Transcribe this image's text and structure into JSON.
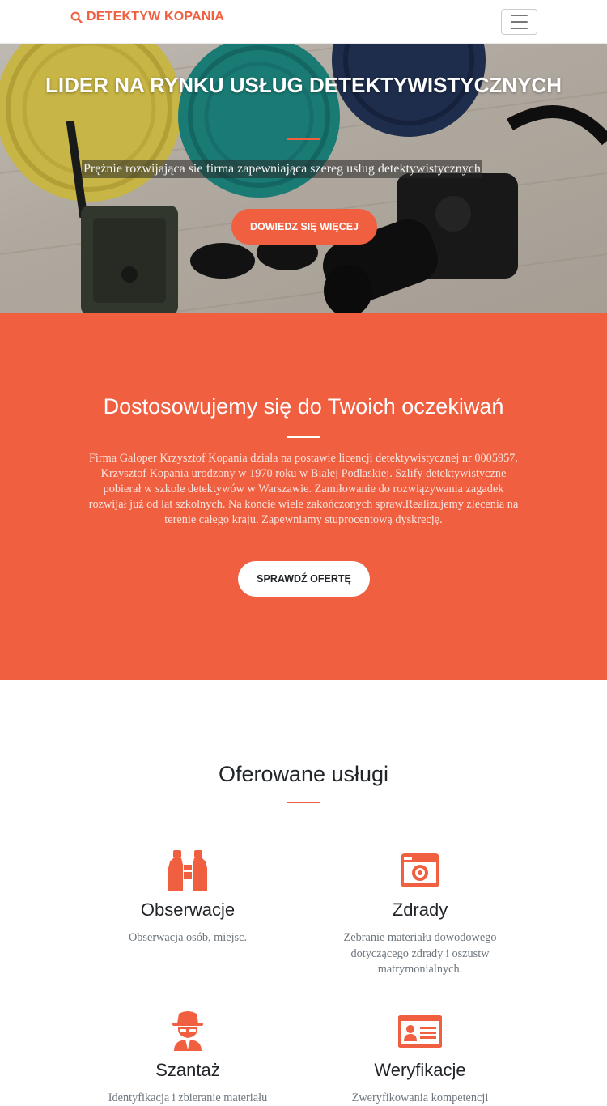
{
  "navbar": {
    "brand": "DETEKTYW KOPANIA",
    "brand_icon": "search-icon",
    "toggler_icon": "hamburger-menu-icon"
  },
  "hero": {
    "title": "LIDER NA RYNKU USŁUG DETEKTYWISTYCZNYCH",
    "subtitle": "Prężnie rozwijająca sie firma zapewniająca szereg usług detektywistycznych",
    "cta": "DOWIEDZ SIĘ WIĘCEJ"
  },
  "about": {
    "heading": "Dostosowujemy się do Twoich oczekiwań",
    "text": "Firma Galoper Krzysztof Kopania działa na postawie licencji detektywistycznej nr 0005957. Krzysztof Kopania urodzony w 1970 roku w Białej Podlaskiej. Szlify detektywistyczne pobierał w szkole detektywów w Warszawie. Zamiłowanie do rozwiązywania zagadek rozwijał już od lat szkolnych. Na koncie wiele zakończonych spraw.Realizujemy zlecenia na terenie całego kraju. Zapewniamy stuprocentową dyskrecję.",
    "cta": "SPRAWDŹ OFERTĘ"
  },
  "services": {
    "heading": "Oferowane usługi",
    "items": [
      {
        "icon": "binoculars-icon",
        "title": "Obserwacje",
        "text": "Obserwacja osób, miejsc."
      },
      {
        "icon": "camera-icon",
        "title": "Zdrady",
        "text": "Zebranie materiału dowodowego dotyczącego zdrady i oszustw matrymonialnych."
      },
      {
        "icon": "spy-icon",
        "title": "Szantaż",
        "text": "Identyfikacja i zbieranie materiału"
      },
      {
        "icon": "id-card-icon",
        "title": "Weryfikacje",
        "text": "Zweryfikowania kompetencji"
      }
    ]
  },
  "colors": {
    "primary": "#f05f40",
    "text": "#212529",
    "muted": "#6c757d"
  }
}
